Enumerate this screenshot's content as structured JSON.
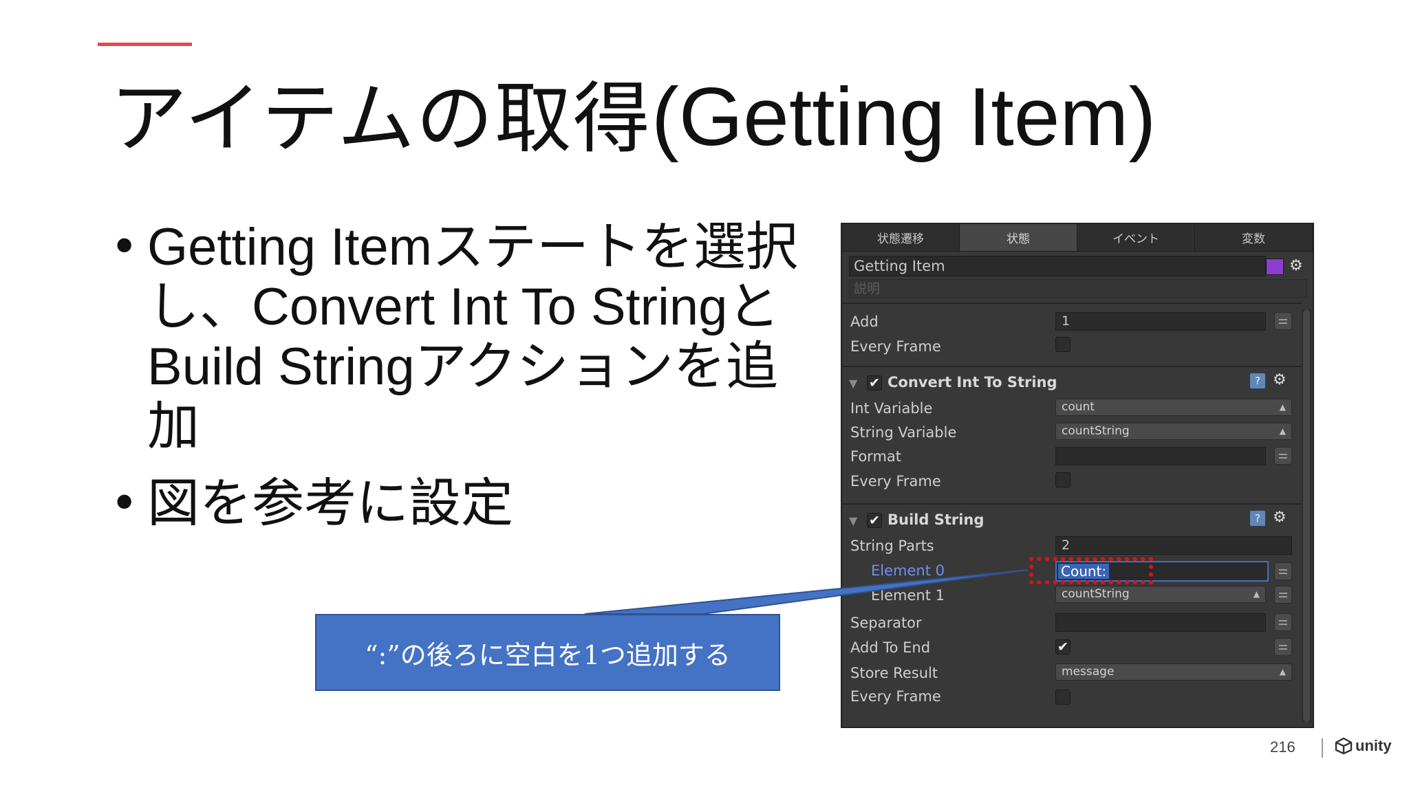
{
  "slide": {
    "title_jp": "アイテムの取得",
    "title_en": "(Getting Item)",
    "bullets": [
      {
        "parts": [
          "Getting Item",
          "ステートを選択し、",
          "Convert Int To String",
          "と",
          "Build String",
          "アクションを追加"
        ]
      },
      {
        "parts": [
          "図を参考に設定"
        ]
      }
    ],
    "callout": "“:”の後ろに空白を1つ追加する",
    "page_number": "216",
    "logo_text": "unity"
  },
  "panel": {
    "tabs": [
      "状態遷移",
      "状態",
      "イベント",
      "変数"
    ],
    "active_tab": 1,
    "state_name": "Getting Item",
    "description_placeholder": "説明",
    "state_color": "#8a3fd0",
    "add_action": {
      "rows": [
        {
          "label": "Add",
          "value": "1"
        },
        {
          "label": "Every Frame",
          "checked": false
        }
      ]
    },
    "convert_int_to_string": {
      "title": "Convert Int To String",
      "enabled": true,
      "int_variable_label": "Int Variable",
      "int_variable_value": "count",
      "string_variable_label": "String Variable",
      "string_variable_value": "countString",
      "format_label": "Format",
      "format_value": "",
      "every_frame_label": "Every Frame",
      "every_frame": false
    },
    "build_string": {
      "title": "Build String",
      "enabled": true,
      "string_parts_label": "String Parts",
      "string_parts_value": "2",
      "element0_label": "Element 0",
      "element0_value": "Count:",
      "element1_label": "Element 1",
      "element1_value": "countString",
      "separator_label": "Separator",
      "separator_value": "",
      "add_to_end_label": "Add To End",
      "add_to_end": true,
      "store_result_label": "Store Result",
      "store_result_value": "message",
      "every_frame_label": "Every Frame",
      "every_frame": false
    }
  },
  "colors": {
    "accent": "#e5484d",
    "callout_bg": "#4472c4",
    "highlight_box": "#e0101a",
    "panel_bg": "#383838"
  }
}
